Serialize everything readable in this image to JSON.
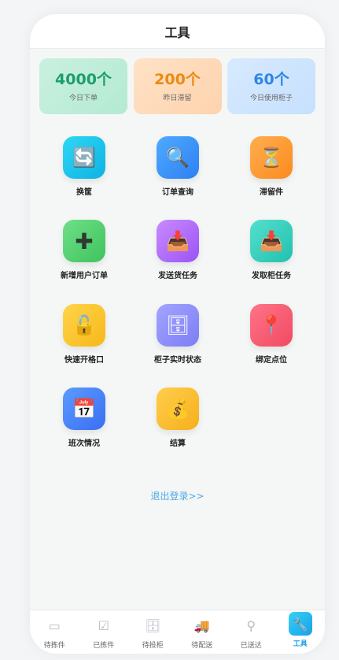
{
  "header": {
    "title": "工具"
  },
  "stats": [
    {
      "value": "4000个",
      "label": "今日下单",
      "theme": "green",
      "color": "#1d9e6a"
    },
    {
      "value": "200个",
      "label": "昨日滞留",
      "theme": "orange",
      "color": "#ec8a12"
    },
    {
      "value": "60个",
      "label": "今日使用柜子",
      "theme": "blue",
      "color": "#2f86e6"
    }
  ],
  "tools": [
    {
      "label": "换筐",
      "icon": "swap-icon",
      "glyph": "🔄"
    },
    {
      "label": "订单查询",
      "icon": "magnifier-icon",
      "glyph": "🔍"
    },
    {
      "label": "滞留件",
      "icon": "hourglass-icon",
      "glyph": "⏳"
    },
    {
      "label": "新增用户订单",
      "icon": "plus-icon",
      "glyph": "✚"
    },
    {
      "label": "发送货任务",
      "icon": "inbox-tray-icon",
      "glyph": "📥"
    },
    {
      "label": "发取柜任务",
      "icon": "inbox-tray-icon",
      "glyph": "📥"
    },
    {
      "label": "快速开格口",
      "icon": "unlock-icon",
      "glyph": "🔓"
    },
    {
      "label": "柜子实时状态",
      "icon": "cabinet-icon",
      "glyph": "🗄"
    },
    {
      "label": "绑定点位",
      "icon": "pin-icon",
      "glyph": "📍"
    },
    {
      "label": "班次情况",
      "icon": "calendar-icon",
      "glyph": "📅"
    },
    {
      "label": "结算",
      "icon": "money-bag-icon",
      "glyph": "💰"
    }
  ],
  "logout": {
    "label": "退出登录>>"
  },
  "tabbar": {
    "items": [
      {
        "label": "待拣件",
        "icon": "clipboard-icon",
        "glyph": "▭",
        "active": false
      },
      {
        "label": "已拣件",
        "icon": "checkbox-icon",
        "glyph": "☑",
        "active": false
      },
      {
        "label": "待投柜",
        "icon": "cabinet-icon",
        "glyph": "🗄",
        "active": false
      },
      {
        "label": "待配送",
        "icon": "truck-icon",
        "glyph": "🚚",
        "active": false
      },
      {
        "label": "已送达",
        "icon": "pin-icon",
        "glyph": "⚲",
        "active": false
      },
      {
        "label": "工具",
        "icon": "wrench-icon",
        "glyph": "🔧",
        "active": true
      }
    ]
  },
  "colors": {
    "accent": "#1a9ee8",
    "link": "#4ea6e8"
  }
}
